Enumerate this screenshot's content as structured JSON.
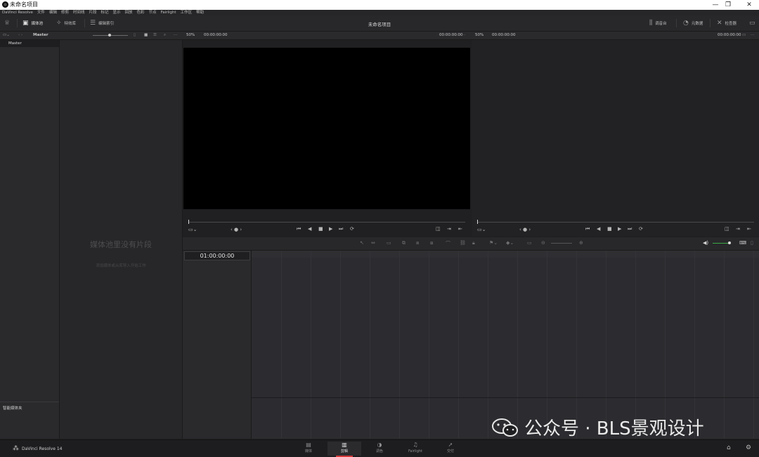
{
  "window": {
    "title": "未命名项目",
    "controls": [
      "—",
      "❐",
      "✕"
    ]
  },
  "menu": [
    "DaVinci Resolve",
    "文件",
    "编辑",
    "修剪",
    "时间线",
    "片段",
    "标记",
    "显示",
    "回放",
    "色彩",
    "节点",
    "Fairlight",
    "工作区",
    "帮助"
  ],
  "toolbar": {
    "media_pool": "媒体池",
    "effects": "特效库",
    "edit_index": "编辑索引",
    "project_title": "未命名项目",
    "mixer": "调音台",
    "metadata": "元数据",
    "inspector": "检查器"
  },
  "subbar": {
    "bin": "Master",
    "src_zoom": "50%",
    "src_timecode_left": "00:00:00:00",
    "src_timecode_right": "00:00:00:00",
    "rec_zoom": "50%",
    "rec_timecode_left": "00:00:00:00",
    "rec_timecode_right": "00:00:00:00"
  },
  "bins": {
    "master": "Master",
    "smart_bins": "智能媒体夹"
  },
  "media_pool": {
    "empty_title": "媒体池里没有片段",
    "empty_hint": "添加媒体或从库导入开始工作"
  },
  "timeline": {
    "timecode": "01:00:00:00"
  },
  "bottom_bar": {
    "app_name": "DaVinci Resolve 14",
    "pages": [
      {
        "label": "媒体",
        "icon": "media-icon"
      },
      {
        "label": "剪辑",
        "icon": "edit-icon",
        "active": true
      },
      {
        "label": "调色",
        "icon": "color-icon"
      },
      {
        "label": "Fairlight",
        "icon": "fairlight-icon"
      },
      {
        "label": "交付",
        "icon": "deliver-icon"
      }
    ]
  },
  "watermark": {
    "text": "公众号 · BLS景观设计"
  }
}
